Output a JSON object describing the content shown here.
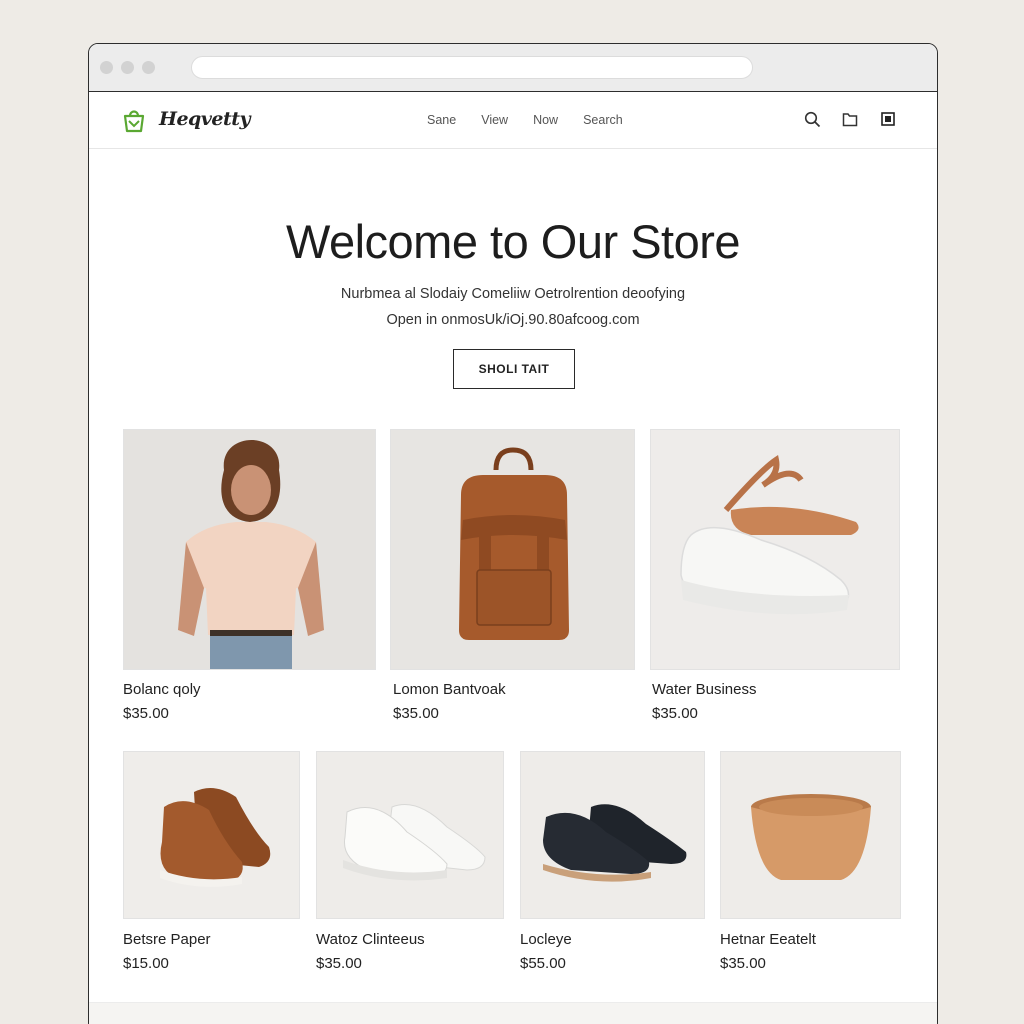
{
  "brand": {
    "name": "Heqvetty"
  },
  "nav": {
    "links": [
      "Sane",
      "View",
      "Now",
      "Search"
    ]
  },
  "icons": [
    "search-icon",
    "folder-icon",
    "image-icon"
  ],
  "hero": {
    "title": "Welcome to Our Store",
    "line1": "Nurbmea al Slodaiy Comeliiw Oetrolrention deoofying",
    "line2": "Open in onmosUk/iOj.90.80afcoog.com",
    "cta": "SHOLI TAIT"
  },
  "products_row1": [
    {
      "name": "Bolanc qoly",
      "price": "$35.00"
    },
    {
      "name": "Lomon Bantvoak",
      "price": "$35.00"
    },
    {
      "name": "Water Business",
      "price": "$35.00"
    }
  ],
  "products_row2": [
    {
      "name": "Betsre Paper",
      "price": "$15.00"
    },
    {
      "name": "Watoz Clinteeus",
      "price": "$35.00"
    },
    {
      "name": "Locleye",
      "price": "$55.00"
    },
    {
      "name": "Hetnar Eeatelt",
      "price": "$35.00"
    }
  ],
  "colors": {
    "accent": "#5aa832",
    "bag": "#a65a2c",
    "text": "#1f1f1f"
  }
}
